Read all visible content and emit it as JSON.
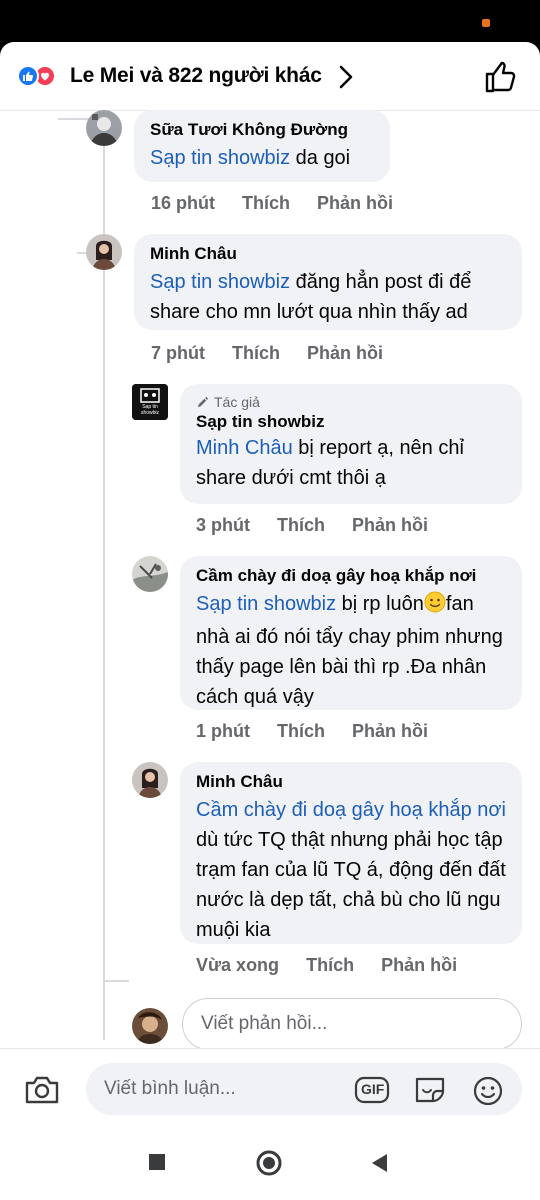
{
  "header": {
    "reactors_text": "Le Mei và 822 người khác"
  },
  "comments": [
    {
      "author": "Sữa Tươi Không Đường",
      "tag": "Sạp tin showbiz",
      "text": " da goi",
      "time": "16 phút",
      "like": "Thích",
      "reply": "Phản hồi"
    },
    {
      "author": "Minh Châu",
      "tag": "Sạp tin showbiz",
      "text": " đăng hẳn post đi để share cho mn lướt qua nhìn thấy ad",
      "time": "7 phút",
      "like": "Thích",
      "reply": "Phản hồi"
    },
    {
      "badge": "Tác giả",
      "author": "Sạp tin showbiz",
      "tag": "Minh Châu",
      "text": " bị report ạ, nên chỉ share dưới cmt thôi ạ",
      "time": "3 phút",
      "like": "Thích",
      "reply": "Phản hồi"
    },
    {
      "author": "Cầm chày đi doạ gây hoạ khắp nơi",
      "tag": "Sạp tin showbiz",
      "text_a": " bị rp luôn",
      "text_b": "fan nhà ai đó nói tẩy chay phim nhưng thấy page lên bài thì rp .Đa nhân cách quá vậy",
      "time": "1 phút",
      "like": "Thích",
      "reply": "Phản hồi"
    },
    {
      "author": "Minh Châu",
      "tag": "Cầm chày đi doạ gây hoạ khắp nơi",
      "text": "  dù tức TQ thật nhưng phải học tập trạm fan của lũ TQ á, động đến đất nước là dẹp tất, chả bù cho lũ ngu muội kia",
      "time": "Vừa xong",
      "like": "Thích",
      "reply": "Phản hồi"
    }
  ],
  "reply_placeholder": "Viết phản hồi...",
  "comment_placeholder": "Viết bình luận...",
  "page_avatar_text": "Sạp tin showbiz",
  "gif_label": "GIF",
  "colors": {
    "link": "#1d5fb8",
    "like": "#1877f2",
    "love": "#f33e58",
    "bubble": "#f0f2f5",
    "meta": "#65676b"
  },
  "icons": [
    "like-icon",
    "love-icon",
    "chevron-right-icon",
    "thumbs-up-icon",
    "pencil-icon",
    "slightly-smiling-emoji",
    "camera-icon",
    "gif-icon",
    "sticker-icon",
    "emoji-icon",
    "nav-square-icon",
    "nav-circle-icon",
    "nav-back-icon"
  ]
}
